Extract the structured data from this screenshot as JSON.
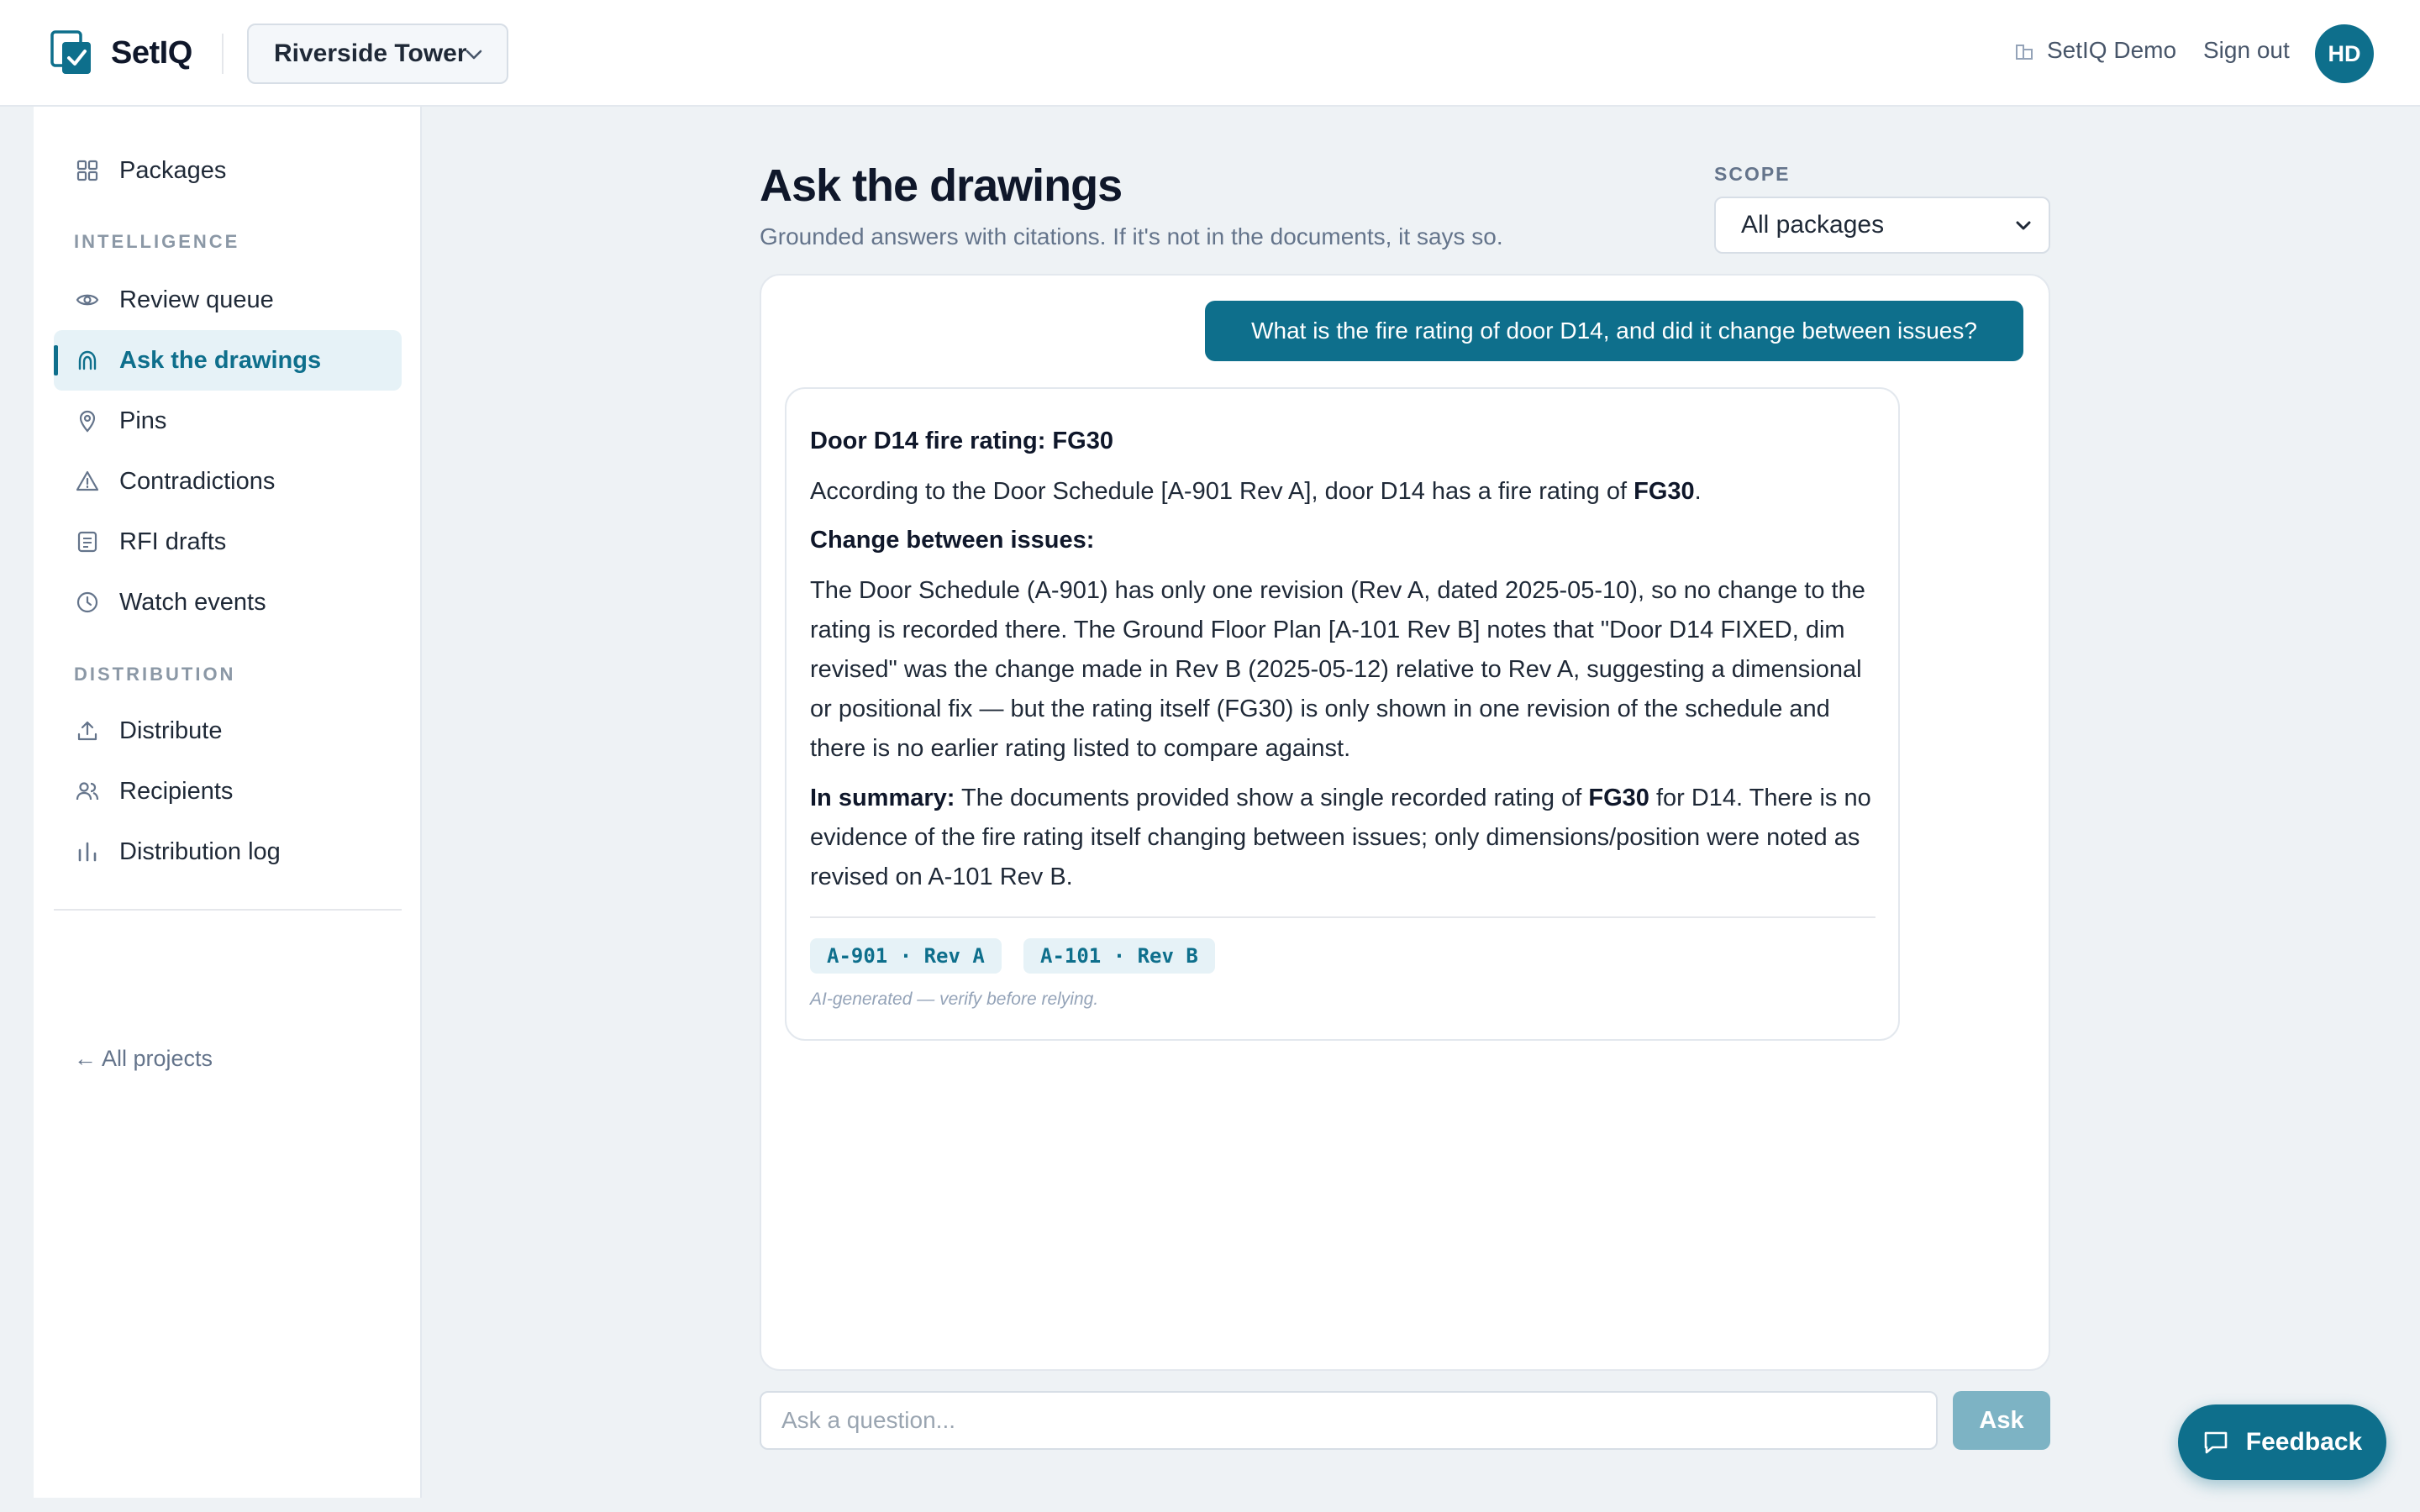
{
  "header": {
    "app_name": "SetIQ",
    "project": "Riverside Tower",
    "org": "SetIQ Demo",
    "sign_out": "Sign out",
    "avatar_initials": "HD"
  },
  "sidebar": {
    "packages": "Packages",
    "intelligence_label": "INTELLIGENCE",
    "intelligence_items": [
      {
        "label": "Review queue",
        "icon": "eye-icon"
      },
      {
        "label": "Ask the drawings",
        "icon": "ask-icon",
        "active": true
      },
      {
        "label": "Pins",
        "icon": "pin-icon"
      },
      {
        "label": "Contradictions",
        "icon": "warning-icon"
      },
      {
        "label": "RFI drafts",
        "icon": "document-icon"
      },
      {
        "label": "Watch events",
        "icon": "clock-icon"
      }
    ],
    "distribution_label": "DISTRIBUTION",
    "distribution_items": [
      {
        "label": "Distribute",
        "icon": "upload-icon"
      },
      {
        "label": "Recipients",
        "icon": "users-icon"
      },
      {
        "label": "Distribution log",
        "icon": "bar-chart-icon"
      }
    ],
    "all_projects": "← All projects"
  },
  "main": {
    "title": "Ask the drawings",
    "subtitle": "Grounded answers with citations. If it's not in the documents, it says so.",
    "scope_label": "SCOPE",
    "scope_value": "All packages",
    "user_question": "What is the fire rating of door D14, and did it change between issues?",
    "answer": {
      "title": "Door D14 fire rating: FG30",
      "p1_text": "According to the Door Schedule [A-901 Rev A], door D14 has a fire rating of ",
      "p1_strong": "FG30",
      "p1_end": ".",
      "heading": "Change between issues:",
      "p2": "The Door Schedule (A-901) has only one revision (Rev A, dated 2025-05-10), so no change to the rating is recorded there. The Ground Floor Plan [A-101 Rev B] notes that \"Door D14 FIXED, dim revised\" was the change made in Rev B (2025-05-12) relative to Rev A, suggesting a dimensional or positional fix — but the rating itself (FG30) is only shown in one revision of the schedule and there is no earlier rating listed to compare against.",
      "summary_label": "In summary:",
      "summary_text": " The documents provided show a single recorded rating of ",
      "summary_strong": "FG30",
      "summary_end": " for D14. There is no evidence of the fire rating itself changing between issues; only dimensions/position were noted as revised on A-101 Rev B.",
      "citations": [
        "A-901 · Rev A",
        "A-101 · Rev B"
      ],
      "note": "AI-generated — verify before relying."
    },
    "ask_placeholder": "Ask a question...",
    "ask_button": "Ask"
  },
  "feedback_button": "Feedback",
  "colors": {
    "accent": "#0e6f8c",
    "accent_light": "#e6f2f7",
    "page_bg": "#eef2f5",
    "ask_button_disabled": "#7db3c4"
  }
}
